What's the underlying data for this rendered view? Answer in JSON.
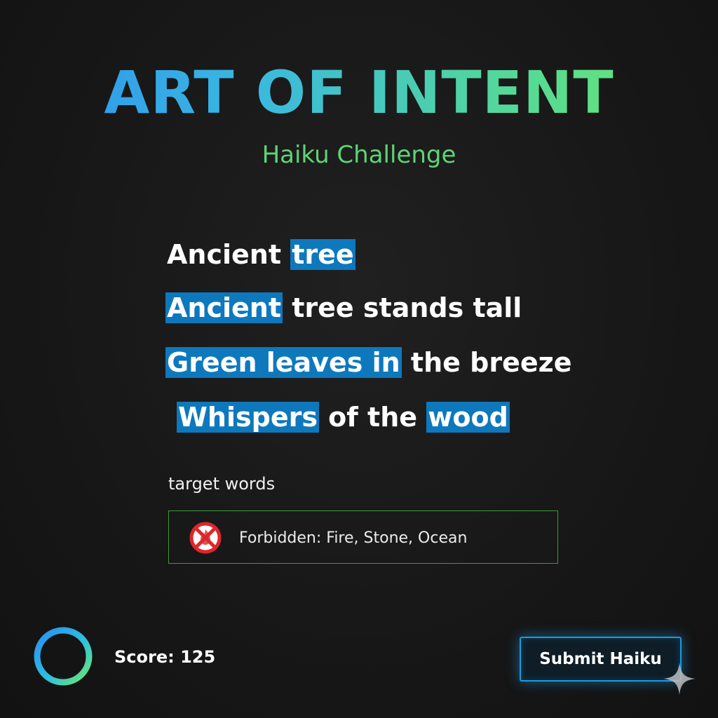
{
  "header": {
    "title": "ART OF INTENT",
    "subtitle": "Haiku Challenge"
  },
  "poem": {
    "lines": [
      [
        {
          "text": "Ancient ",
          "highlight": false
        },
        {
          "text": "tree",
          "highlight": true
        }
      ],
      [
        {
          "text": "Ancient",
          "highlight": true
        },
        {
          "text": " tree stands tall",
          "highlight": false
        }
      ],
      [
        {
          "text": "Green leaves in",
          "highlight": true
        },
        {
          "text": " the breeze",
          "highlight": false
        }
      ],
      [
        {
          "text": "Whispers",
          "highlight": true
        },
        {
          "text": " of the ",
          "highlight": false
        },
        {
          "text": "wood",
          "highlight": true
        }
      ]
    ]
  },
  "targets": {
    "label": "target words"
  },
  "forbidden": {
    "text": "Forbidden: Fire, Stone, Ocean",
    "icon": "no-fire-icon"
  },
  "score": {
    "text": "Score: 125",
    "icon": "progress-ring-icon"
  },
  "actions": {
    "submit_label": "Submit Haiku"
  },
  "decor": {
    "icon": "sparkle-icon"
  },
  "colors": {
    "title_gradient_start": "#2b8ff0",
    "title_gradient_end": "#6ee86a",
    "subtitle": "#5fd375",
    "highlight": "#0e78bd",
    "forbidden_border": "#3e9a3a",
    "button_border": "#1a9be0"
  }
}
